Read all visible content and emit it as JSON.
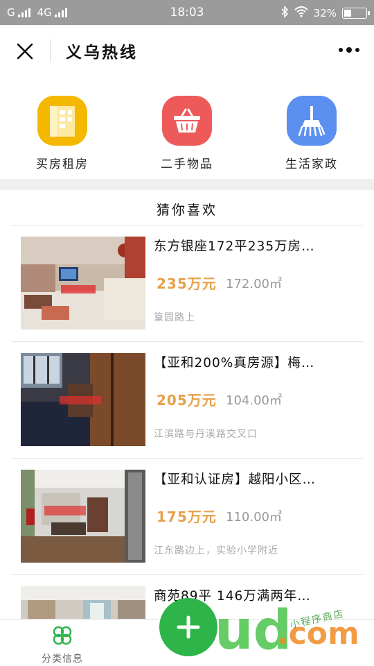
{
  "status_bar": {
    "carrier1": "G",
    "carrier2": "4G",
    "time": "18:03",
    "battery": "32%"
  },
  "nav": {
    "title": "义乌热线"
  },
  "categories": [
    {
      "label": "买房租房",
      "icon": "building-icon",
      "color": "#f5b800"
    },
    {
      "label": "二手物品",
      "icon": "basket-icon",
      "color": "#ee5a5a"
    },
    {
      "label": "生活家政",
      "icon": "broom-icon",
      "color": "#5b8ff0"
    }
  ],
  "section": {
    "title": "猜你喜欢"
  },
  "listings": [
    {
      "title": "东方银座172平235万房…",
      "price": "235万元",
      "area": "172.00㎡",
      "address": "篁园路上"
    },
    {
      "title": "【亚和200%真房源】梅…",
      "price": "205万元",
      "area": "104.00㎡",
      "address": "江滨路与丹溪路交叉口"
    },
    {
      "title": "【亚和认证房】越阳小区…",
      "price": "175万元",
      "area": "110.00㎡",
      "address": "江东路边上，实验小学附近"
    },
    {
      "title": "商苑89平 146万满两年…",
      "price": "",
      "area": "",
      "address": ""
    }
  ],
  "tab_bar": {
    "tab1_label": "分类信息",
    "tab1_icon": "clover-icon"
  },
  "watermark": {
    "text_small": "小程序商店",
    "text_big": ".com",
    "text_logo": "ud"
  },
  "colors": {
    "accent_green": "#2fb44a",
    "price_orange": "#e6a04a"
  }
}
